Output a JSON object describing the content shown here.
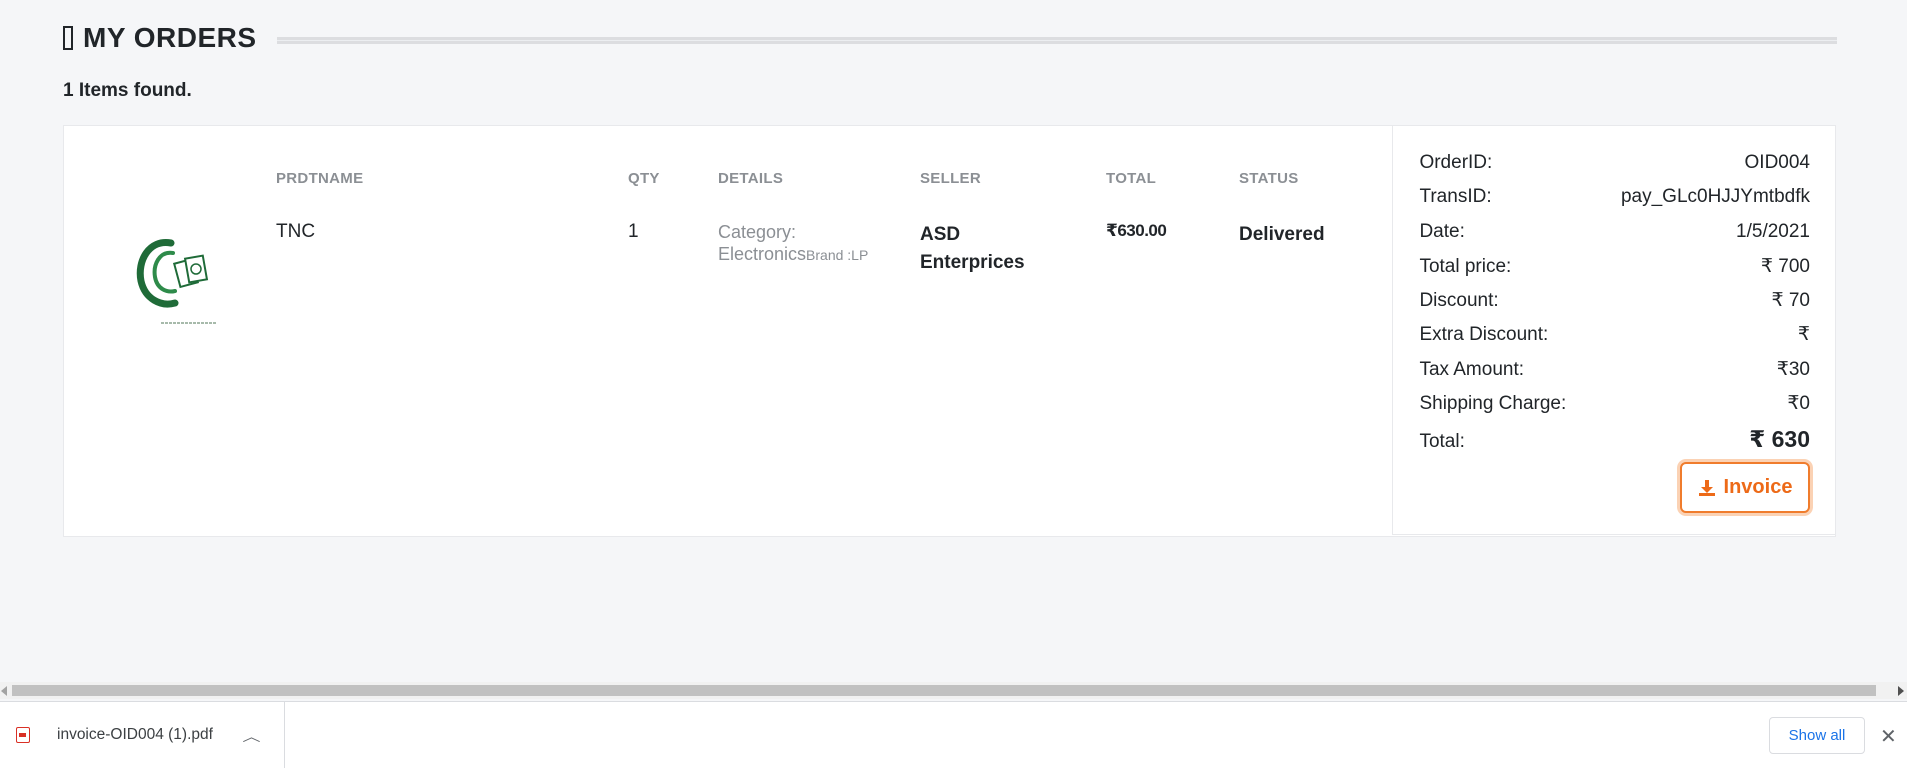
{
  "header": {
    "title": "MY ORDERS",
    "icon": "square-icon"
  },
  "items_found": "1 Items found.",
  "columns": {
    "name": "PRDTNAME",
    "qty": "QTY",
    "details": "DETAILS",
    "seller": "SELLER",
    "total": "TOTAL",
    "status": "STATUS"
  },
  "order": {
    "product_name": "TNC",
    "qty": "1",
    "category": "Category: Electronics",
    "brand": "Brand :LP",
    "seller_line1": "ASD",
    "seller_line2": "Enterprices",
    "total": "₹630.00",
    "status": "Delivered"
  },
  "summary": {
    "rows": [
      {
        "label": "OrderID:",
        "value": "OID004"
      },
      {
        "label": "TransID:",
        "value": "pay_GLc0HJJYmtbdfk"
      },
      {
        "label": "Date:",
        "value": "1/5/2021"
      },
      {
        "label": "Total price:",
        "value": "₹ 700"
      },
      {
        "label": "Discount:",
        "value": "₹ 70"
      },
      {
        "label": "Extra Discount:",
        "value": "₹"
      },
      {
        "label": "Tax Amount:",
        "value": "₹30"
      },
      {
        "label": "Shipping Charge:",
        "value": "₹0"
      },
      {
        "label": "Total:",
        "value": "₹ 630"
      }
    ],
    "invoice_label": "Invoice",
    "invoice_icon": "download-icon"
  },
  "download_bar": {
    "file_name": "invoice-OID004 (1).pdf",
    "file_icon": "pdf-icon",
    "show_all_label": "Show all",
    "close_icon": "close-icon"
  },
  "colors": {
    "accent": "#ed6a18",
    "logo_green": "#1f6b38",
    "link_blue": "#1a73e8"
  }
}
